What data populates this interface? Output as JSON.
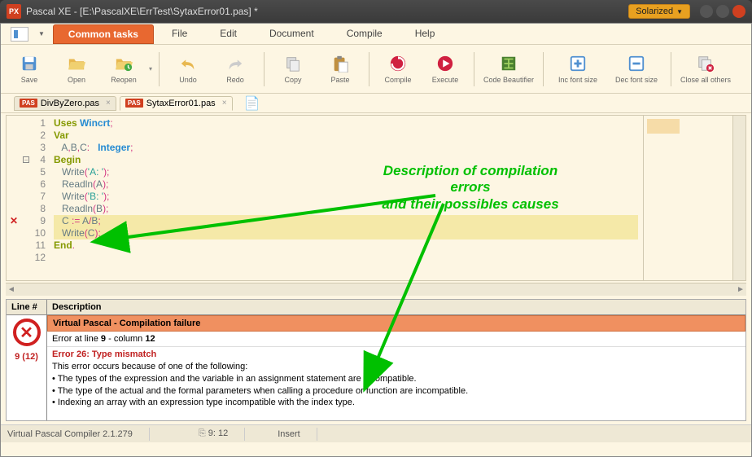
{
  "window": {
    "app_badge": "PX",
    "title": "Pascal XE  -  [E:\\PascalXE\\ErrTest\\SytaxError01.pas] *",
    "theme_button": "Solarized"
  },
  "menu": {
    "tabs": [
      "Common tasks",
      "File",
      "Edit",
      "Document",
      "Compile",
      "Help"
    ],
    "active_index": 0
  },
  "toolbar": {
    "items": [
      {
        "label": "Save",
        "icon": "save"
      },
      {
        "label": "Open",
        "icon": "open"
      },
      {
        "label": "Reopen",
        "icon": "reopen"
      },
      {
        "sep": true
      },
      {
        "label": "Undo",
        "icon": "undo"
      },
      {
        "label": "Redo",
        "icon": "redo"
      },
      {
        "sep": true
      },
      {
        "label": "Copy",
        "icon": "copy"
      },
      {
        "label": "Paste",
        "icon": "paste"
      },
      {
        "sep": true
      },
      {
        "label": "Compile",
        "icon": "compile"
      },
      {
        "label": "Execute",
        "icon": "execute"
      },
      {
        "sep": true
      },
      {
        "label": "Code Beautifier",
        "icon": "beautifier"
      },
      {
        "sep": true
      },
      {
        "label": "Inc font size",
        "icon": "plus"
      },
      {
        "label": "Dec font size",
        "icon": "minus"
      },
      {
        "sep": true
      },
      {
        "label": "Close all others",
        "icon": "closeall"
      }
    ]
  },
  "file_tabs": {
    "items": [
      {
        "label": "DivByZero.pas",
        "active": false
      },
      {
        "label": "SytaxError01.pas",
        "active": true
      }
    ]
  },
  "code": {
    "lines": [
      {
        "n": 1,
        "html": "<span class='kw'>Uses</span> <span class='type'>Wincrt</span><span class='sym'>;</span>"
      },
      {
        "n": 2,
        "html": "<span class='kw'>Var</span>"
      },
      {
        "n": 3,
        "html": "   <span class='ident'>A</span><span class='sym'>,</span><span class='ident'>B</span><span class='sym'>,</span><span class='ident'>C</span><span class='sym'>:</span>   <span class='type'>Integer</span><span class='sym'>;</span>"
      },
      {
        "n": 4,
        "fold": true,
        "html": "<span class='kw'>Begin</span>"
      },
      {
        "n": 5,
        "html": "   <span class='ident'>Write</span><span class='sym'>(</span><span class='str'>'A: '</span><span class='sym'>);</span>"
      },
      {
        "n": 6,
        "html": "   <span class='ident'>Readln</span><span class='sym'>(</span><span class='ident'>A</span><span class='sym'>);</span>"
      },
      {
        "n": 7,
        "html": "   <span class='ident'>Write</span><span class='sym'>(</span><span class='str'>'B: '</span><span class='sym'>);</span>"
      },
      {
        "n": 8,
        "html": "   <span class='ident'>Readln</span><span class='sym'>(</span><span class='ident'>B</span><span class='sym'>);</span>"
      },
      {
        "n": 9,
        "err": true,
        "highlight": true,
        "html": "   <span class='ident'>C</span> <span class='sym'>:=</span> <span class='ident'>A</span><span class='sym'>/</span><span class='ident'>B</span><span class='sym'>;</span>"
      },
      {
        "n": 10,
        "highlight": true,
        "html": "   <span class='ident'>Write</span><span class='sym'>(</span><span class='ident'>C</span><span class='sym'>);</span>"
      },
      {
        "n": 11,
        "html": "<span class='kw'>End</span><span class='sym'>.</span>"
      },
      {
        "n": 12,
        "html": ""
      }
    ]
  },
  "error_panel": {
    "headers": {
      "line": "Line #",
      "desc": "Description"
    },
    "vp_title": "Virtual Pascal - Compilation failure",
    "line_text_prefix": "Error at line ",
    "line_num": "9",
    "col_text": " - column ",
    "col_num": "12",
    "err_lineno": "9 (12)",
    "err_title": "Error 26: Type mismatch",
    "body": [
      "This error occurs because of one of the following:",
      "• The types of the expression and the variable in an assignment statement are incompatible.",
      "• The type of the actual and the formal parameters when calling a procedure or function are incompatible.",
      "• Indexing an array with an expression type incompatible with the index type."
    ]
  },
  "status": {
    "compiler": "Virtual Pascal Compiler 2.1.279",
    "pos": "9: 12",
    "mode": "Insert"
  },
  "annotation": {
    "text1": "Description of compilation errors",
    "text2": "and their possibles causes"
  }
}
